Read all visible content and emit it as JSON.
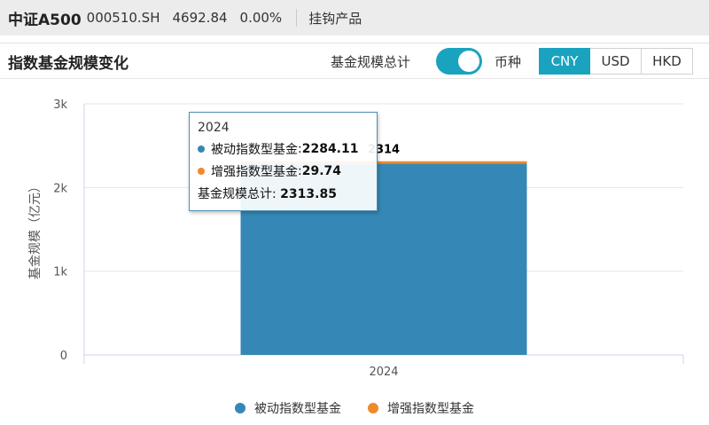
{
  "header": {
    "index_name": "中证A500",
    "index_code": "000510.SH",
    "price": "4692.84",
    "change": "0.00%",
    "link": "挂钩产品"
  },
  "panel": {
    "title": "指数基金规模变化",
    "total_label": "基金规模总计",
    "total_toggle_on": true,
    "currency_label": "币种",
    "currencies": [
      "CNY",
      "USD",
      "HKD"
    ],
    "selected_currency": "CNY"
  },
  "tooltip": {
    "title": "2024",
    "rows": [
      {
        "name": "被动指数型基金",
        "value": "2284.11"
      },
      {
        "name": "增强指数型基金",
        "value": "29.74"
      }
    ],
    "total_label": "基金规模总计",
    "total_value": "2313.85"
  },
  "colors": {
    "accent": "#1aa3bf",
    "passive": "#3588b5",
    "enhanced": "#f0892a"
  },
  "chart_data": {
    "type": "bar",
    "stacked": true,
    "categories": [
      "2024"
    ],
    "series": [
      {
        "name": "被动指数型基金",
        "values": [
          2284.11
        ]
      },
      {
        "name": "增强指数型基金",
        "values": [
          29.74
        ]
      }
    ],
    "total_values": [
      2313.85
    ],
    "total_label_text": "2314",
    "ylabel": "基金规模（亿元）",
    "xlabel": "",
    "ylim": [
      0,
      3000
    ],
    "yticks": [
      0,
      1000,
      2000,
      3000
    ],
    "ytick_labels": [
      "0",
      "1k",
      "2k",
      "3k"
    ],
    "grid": true,
    "legend_position": "bottom"
  }
}
